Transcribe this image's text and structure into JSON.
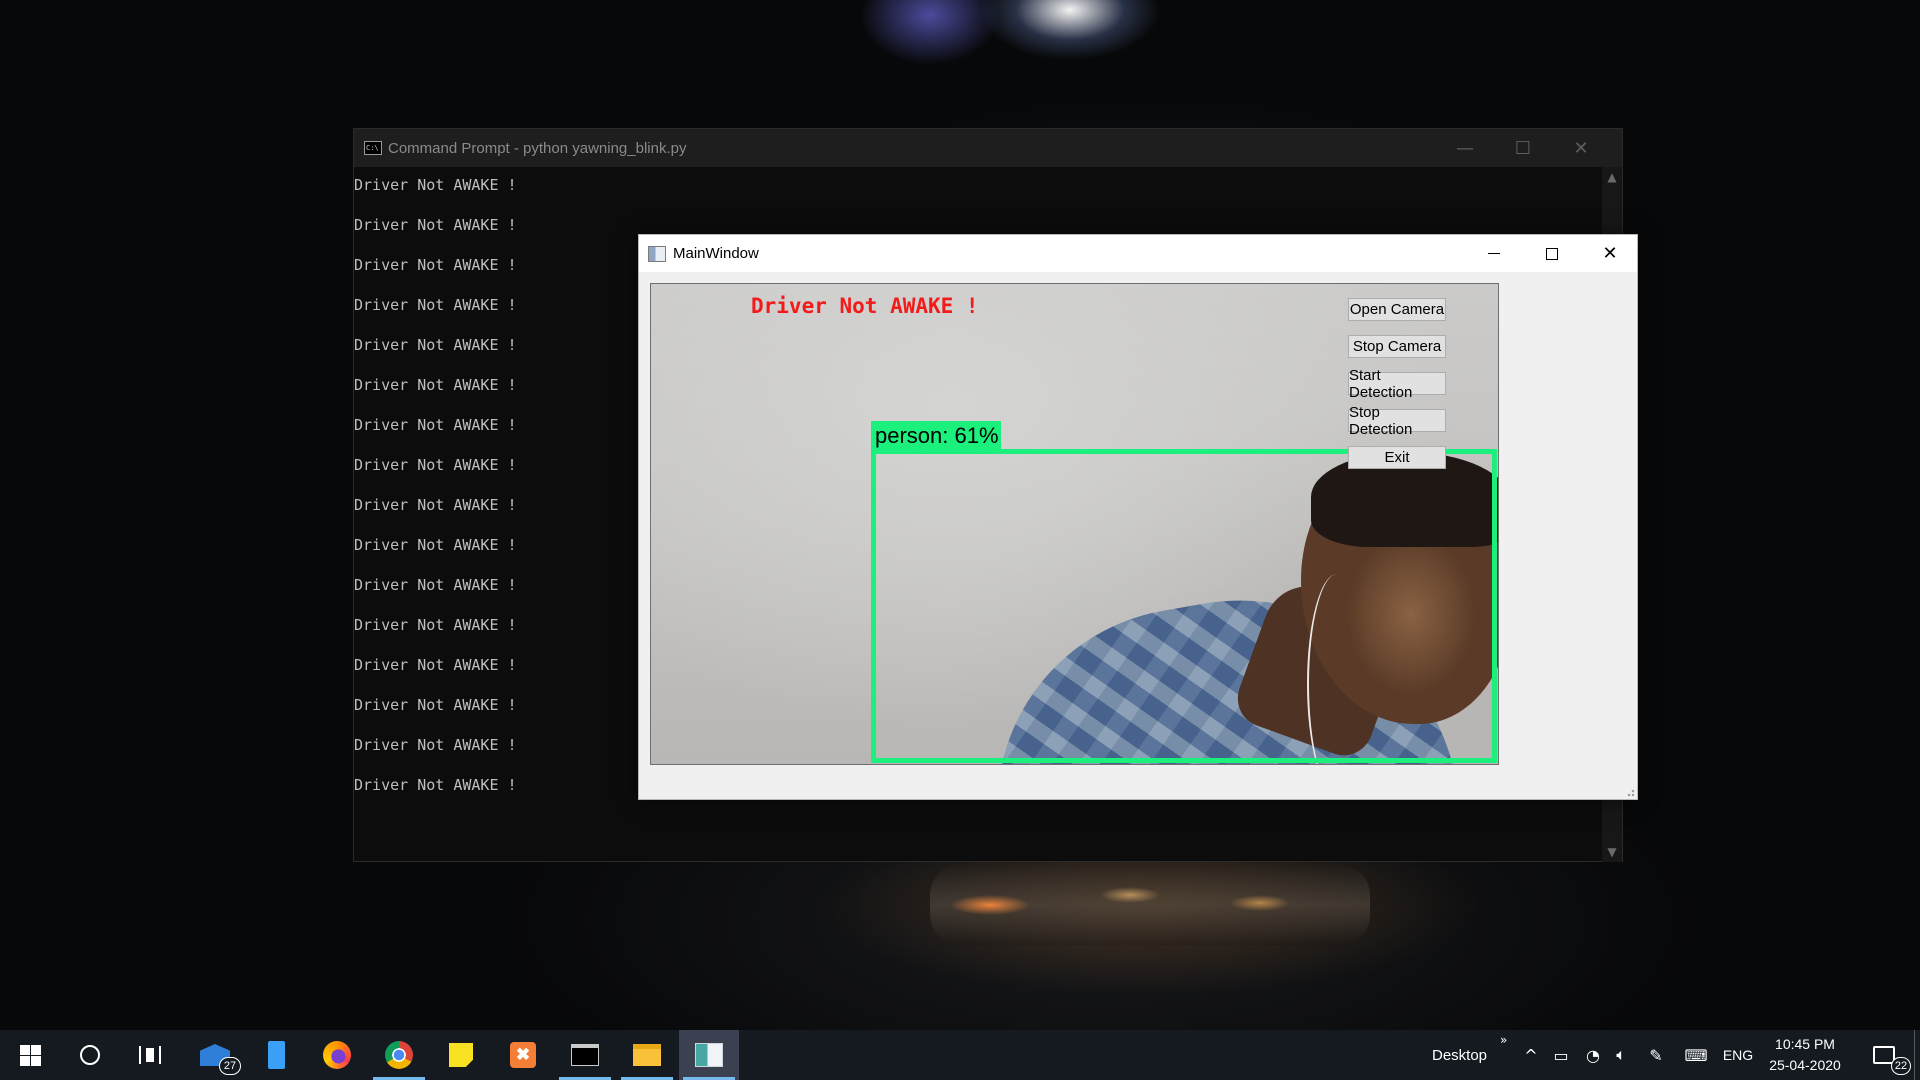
{
  "cmd": {
    "title": "Command Prompt - python  yawning_blink.py",
    "lines": [
      "Driver Not AWAKE !",
      "Driver Not AWAKE !",
      "Driver Not AWAKE !",
      "Driver Not AWAKE !",
      "Driver Not AWAKE !",
      "Driver Not AWAKE !",
      "Driver Not AWAKE !",
      "Driver Not AWAKE !",
      "Driver Not AWAKE !",
      "Driver Not AWAKE !",
      "Driver Not AWAKE !",
      "Driver Not AWAKE !",
      "Driver Not AWAKE !",
      "Driver Not AWAKE !",
      "Driver Not AWAKE !",
      "Driver Not AWAKE !"
    ],
    "minimize_icon": "minimize-icon",
    "maximize_icon": "maximize-icon",
    "close_icon": "close-icon"
  },
  "main_window": {
    "title": "MainWindow",
    "camera": {
      "alert_text": "Driver Not AWAKE !",
      "detection_label": "person: 61%",
      "alert_color": "#f21b1b",
      "box_color": "#1cf07c"
    },
    "buttons": {
      "open_camera": "Open Camera",
      "stop_camera": "Stop Camera",
      "start_detection": "Start Detection",
      "stop_detection": "Stop Detection",
      "exit": "Exit"
    }
  },
  "taskbar": {
    "mail_badge": "27",
    "desktop_label": "Desktop",
    "desktop_chevron": "»",
    "language": "ENG",
    "time": "10:45 PM",
    "date": "25-04-2020",
    "notification_count": "22",
    "accent": "#76b9ed",
    "icons": [
      "windows-start-icon",
      "cortana-icon",
      "task-view-icon",
      "mail-icon",
      "notepad-icon",
      "firefox-icon",
      "chrome-icon",
      "sticky-notes-icon",
      "xampp-icon",
      "command-prompt-icon",
      "file-explorer-icon",
      "python-app-icon"
    ]
  }
}
